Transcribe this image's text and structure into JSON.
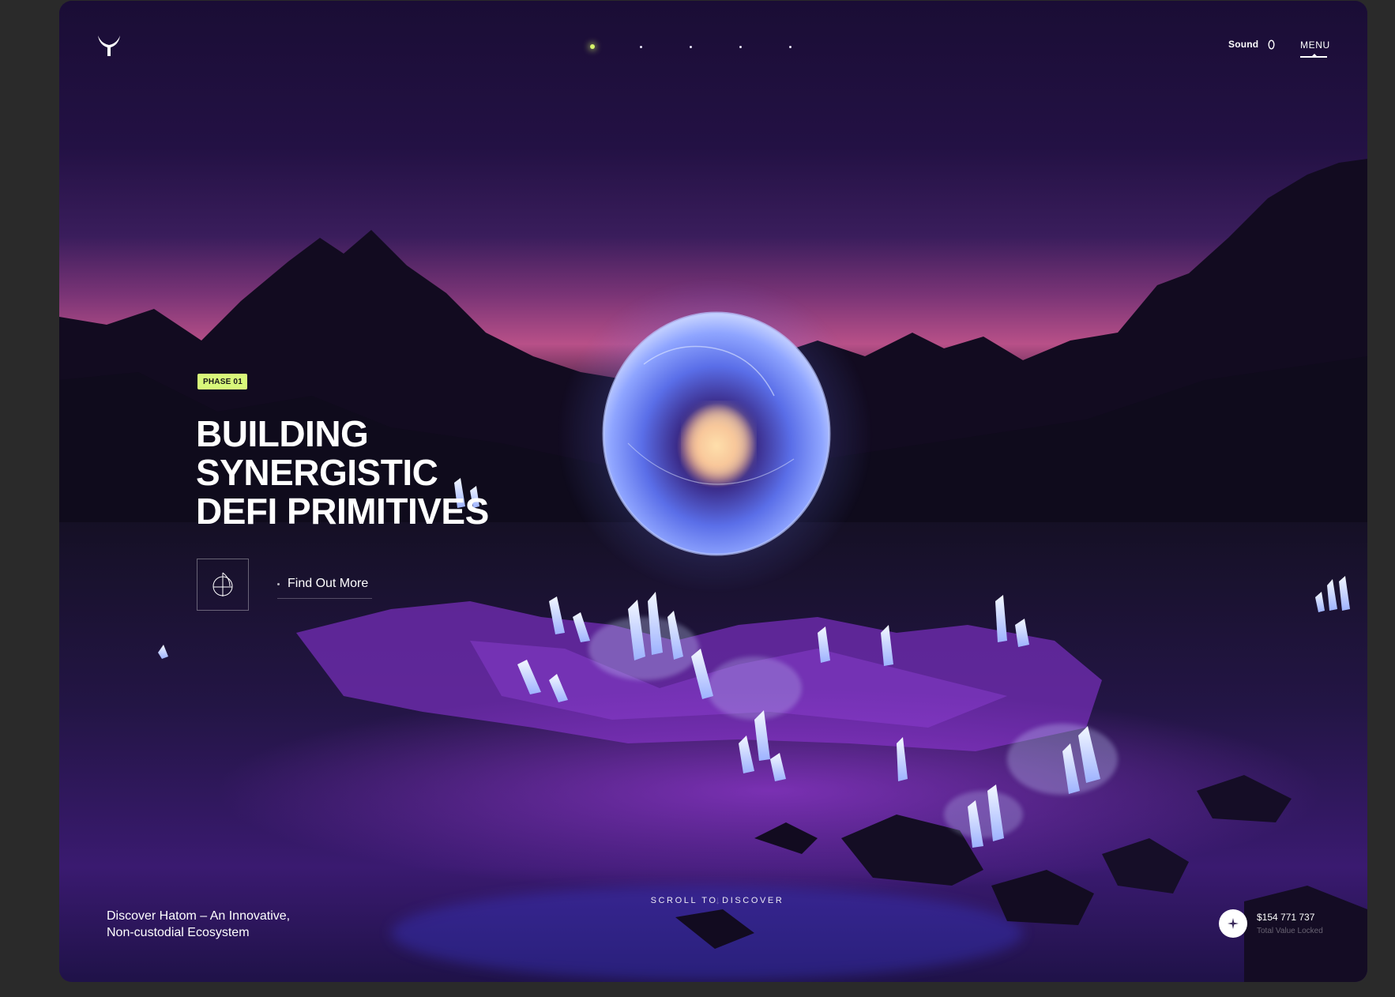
{
  "header": {
    "logo_icon": "hatom-logo-icon",
    "dots": [
      {
        "active": true
      },
      {
        "active": false
      },
      {
        "active": false
      },
      {
        "active": false
      },
      {
        "active": false
      }
    ],
    "sound_label": "Sound",
    "sound_icon": "sound-toggle-icon",
    "menu_label": "MENU"
  },
  "hero": {
    "badge": "PHASE 01",
    "headline": [
      "BUILDING",
      "SYNERGISTIC",
      "DEFI PRIMITIVES"
    ],
    "cta_icon": "globe-icon",
    "cta_label": "Find Out More"
  },
  "footer": {
    "tagline": [
      "Discover Hatom – An Innovative,",
      "Non-custodial Ecosystem"
    ],
    "scroll_label": "SCROLL TO DISCOVER",
    "scroll_icon": "arrow-down-icon",
    "scroll_arrow": "↓",
    "tvl_icon": "sparkle-icon",
    "tvl_value": "$154 771 737",
    "tvl_label": "Total Value Locked"
  },
  "colors": {
    "accent": "#d8f87a",
    "background": "#1a0f3a",
    "sky_top": "#1a0f3a",
    "sky_horizon": "#b8508a",
    "glow": "#6a7cff"
  }
}
